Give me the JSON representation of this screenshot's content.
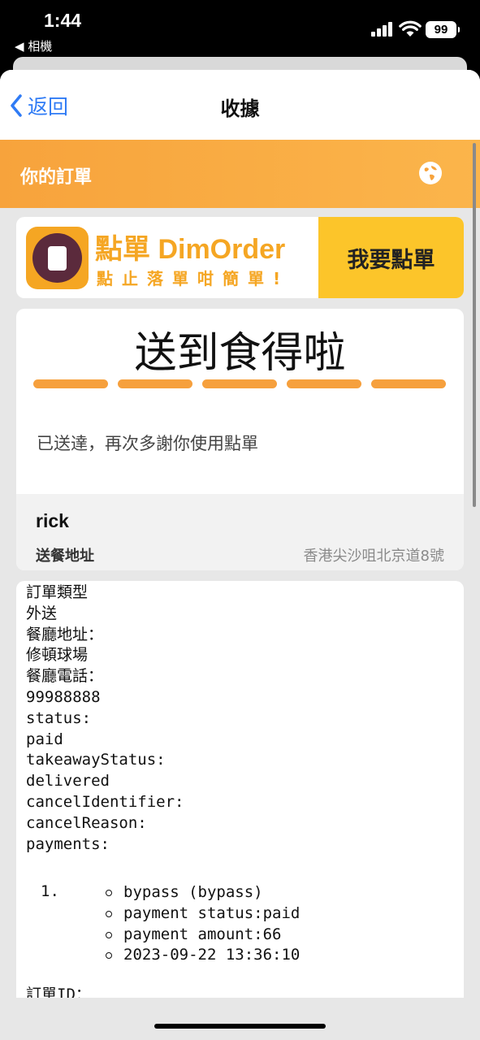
{
  "status_bar": {
    "time": "1:44",
    "back_app": "◀ 相機",
    "battery": "99"
  },
  "nav": {
    "back_label": "返回",
    "title": "收據"
  },
  "header": {
    "title": "你的訂單"
  },
  "banner": {
    "brand": "點單 DimOrder",
    "slogan": "點止落單咁簡單!",
    "order_button": "我要點單"
  },
  "status_card": {
    "title": "送到食得啦",
    "progress_steps_completed": 5,
    "progress_steps_total": 5,
    "message": "已送達，再次多謝你使用點單",
    "customer_name": "rick",
    "address_label": "送餐地址",
    "address_value": "香港尖沙咀北京道8號"
  },
  "details": {
    "lines": [
      "訂單類型",
      "外送",
      "餐廳地址：",
      "修頓球場",
      "餐廳電話：",
      "99988888",
      "status:",
      "paid",
      "takeawayStatus:",
      "delivered",
      "cancelIdentifier:",
      "cancelReason:",
      "payments:"
    ],
    "payment_index": "1.",
    "payment_items": [
      "bypass (bypass)",
      "payment status:paid",
      "payment amount:66",
      "2023-09-22 13:36:10"
    ],
    "order_id_label": "訂單ID："
  }
}
